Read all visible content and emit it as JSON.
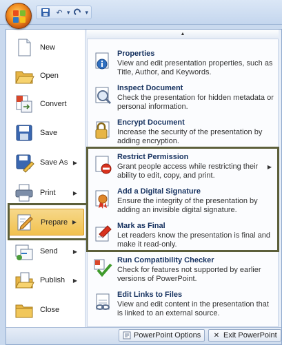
{
  "quick_access": {
    "save_icon": "save-icon",
    "undo_icon": "undo-icon",
    "redo_icon": "redo-icon",
    "customize_icon": "customize-qat-icon"
  },
  "left_menu": [
    {
      "label": "New",
      "icon": "new-document-icon",
      "has_submenu": false
    },
    {
      "label": "Open",
      "icon": "open-folder-icon",
      "has_submenu": false
    },
    {
      "label": "Convert",
      "icon": "convert-icon",
      "has_submenu": false
    },
    {
      "label": "Save",
      "icon": "save-disk-icon",
      "has_submenu": false
    },
    {
      "label": "Save As",
      "icon": "save-as-icon",
      "has_submenu": true
    },
    {
      "label": "Print",
      "icon": "printer-icon",
      "has_submenu": true
    },
    {
      "label": "Prepare",
      "icon": "prepare-icon",
      "has_submenu": true,
      "selected": true
    },
    {
      "label": "Send",
      "icon": "send-icon",
      "has_submenu": true
    },
    {
      "label": "Publish",
      "icon": "publish-icon",
      "has_submenu": true
    },
    {
      "label": "Close",
      "icon": "close-folder-icon",
      "has_submenu": false
    }
  ],
  "right_menu": [
    {
      "title": "Properties",
      "desc": "View and edit presentation properties, such as Title, Author, and Keywords.",
      "icon": "properties-icon"
    },
    {
      "title": "Inspect Document",
      "desc": "Check the presentation for hidden metadata or personal information.",
      "icon": "inspect-document-icon"
    },
    {
      "title": "Encrypt Document",
      "desc": "Increase the security of the presentation by adding encryption.",
      "icon": "encrypt-lock-icon"
    },
    {
      "title": "Restrict Permission",
      "desc": "Grant people access while restricting their ability to edit, copy, and print.",
      "icon": "restrict-permission-icon",
      "has_submenu": true
    },
    {
      "title": "Add a Digital Signature",
      "desc": "Ensure the integrity of the presentation by adding an invisible digital signature.",
      "icon": "digital-signature-icon"
    },
    {
      "title": "Mark as Final",
      "desc": "Let readers know the presentation is final and make it read-only.",
      "icon": "mark-final-icon"
    },
    {
      "title": "Run Compatibility Checker",
      "desc": "Check for features not supported by earlier versions of PowerPoint.",
      "icon": "compatibility-checker-icon"
    },
    {
      "title": "Edit Links to Files",
      "desc": "View and edit content in the presentation that is linked to an external source.",
      "icon": "edit-links-icon"
    }
  ],
  "bottom": {
    "options_label": "PowerPoint Options",
    "exit_label": "Exit PowerPoint"
  },
  "colors": {
    "accent_selected": "#f2c14e",
    "highlight_box": "#5c5f3a",
    "title_blue": "#15315f"
  }
}
